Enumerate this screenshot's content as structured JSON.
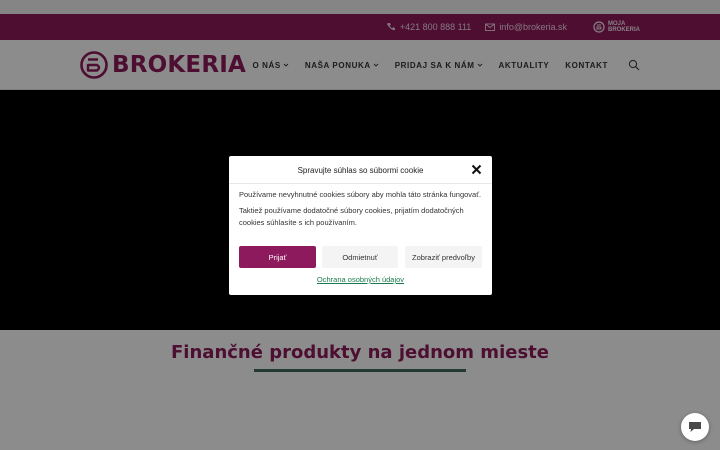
{
  "topbar": {
    "phone": "+421 800 888 111",
    "email": "info@brokeria.sk",
    "moja_line1": "MOJA",
    "moja_line2": "BROKERIA"
  },
  "header": {
    "logo_text": "BROKERIA",
    "nav": [
      {
        "label": "O NÁS",
        "has_dropdown": true
      },
      {
        "label": "NAŠA PONUKA",
        "has_dropdown": true
      },
      {
        "label": "PRIDAJ SA K NÁM",
        "has_dropdown": true
      },
      {
        "label": "AKTUALITY",
        "has_dropdown": false
      },
      {
        "label": "KONTAKT",
        "has_dropdown": false
      }
    ]
  },
  "section": {
    "title": "Finančné produkty na jednom mieste"
  },
  "cookie_modal": {
    "title": "Spravujte súhlas so súbormi cookie",
    "text1": "Používame nevyhnutné cookies súbory aby mohla táto stránka fungovať.",
    "text2": "Taktiež používame dodatočné súbory cookies, prijatím dodatočných cookies súhlasíte s ich používaním.",
    "accept": "Prijať",
    "deny": "Odmietnuť",
    "preferences": "Zobraziť predvoľby",
    "privacy_link": "Ochrana osobných údajov"
  },
  "colors": {
    "brand": "#8c1a5c",
    "accent_line": "#3f6a5e",
    "link": "#1a7a4e"
  }
}
